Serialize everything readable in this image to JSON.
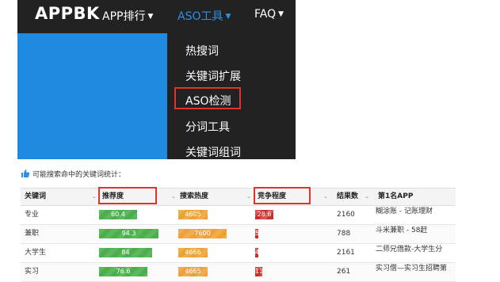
{
  "navbar": {
    "brand": "APPBK",
    "items": [
      {
        "label": "APP排行"
      },
      {
        "label": "ASO工具"
      },
      {
        "label": "FAQ"
      }
    ]
  },
  "dropdown": {
    "items": [
      {
        "label": "热搜词"
      },
      {
        "label": "关键词扩展"
      },
      {
        "label": "ASO检测"
      },
      {
        "label": "分词工具"
      },
      {
        "label": "关键词组词"
      }
    ]
  },
  "stats": {
    "title": "可能搜索命中的关键词统计：",
    "columns": [
      "关键词",
      "推荐度",
      "搜索热度",
      "竞争程度",
      "结果数",
      "第1名APP"
    ],
    "rows": [
      {
        "keyword": "专业",
        "recommend": "60.4",
        "recommend_pct": 60.4,
        "heat": "4605",
        "heat_pct": 46,
        "competition": "28.6",
        "competition_pct": 28.6,
        "results": "2160",
        "top_app": "糊涂账 - 记账理财"
      },
      {
        "keyword": "兼职",
        "recommend": "94.3",
        "recommend_pct": 94.3,
        "heat": "7600",
        "heat_pct": 76,
        "competition": "5",
        "competition_pct": 5,
        "results": "788",
        "top_app": "斗米兼职 - 58赶"
      },
      {
        "keyword": "大学生",
        "recommend": "84",
        "recommend_pct": 84,
        "heat": "4666",
        "heat_pct": 46.7,
        "competition": "4",
        "competition_pct": 4,
        "results": "2161",
        "top_app": "二师兄借款-大学生分"
      },
      {
        "keyword": "实习",
        "recommend": "76.6",
        "recommend_pct": 76.6,
        "heat": "4665",
        "heat_pct": 46.7,
        "competition": "11",
        "competition_pct": 11,
        "results": "261",
        "top_app": "实习僧—实习生招聘第"
      }
    ]
  },
  "colors": {
    "nav_bg": "#222222",
    "accent": "#2f8fe6",
    "highlight_border": "#e0342a",
    "bar_green": "#5cb85c",
    "bar_orange": "#f0ad4e",
    "bar_red": "#d9534f"
  }
}
